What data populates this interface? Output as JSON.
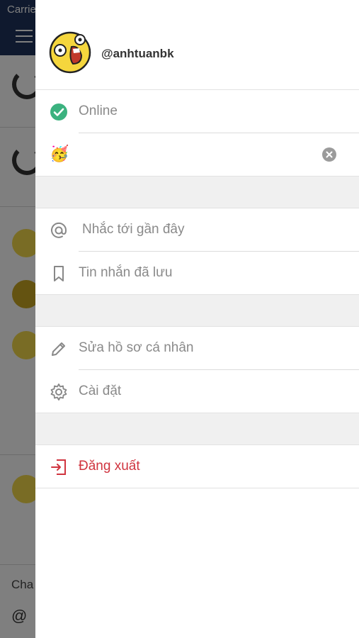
{
  "status_bar": {
    "carrier": "Carrie"
  },
  "background": {
    "footer_text": "Cha",
    "footer_at": "@"
  },
  "drawer": {
    "username": "@anhtuanbk",
    "status": {
      "label": "Online",
      "color": "#3bb27f"
    },
    "custom_status": {
      "emoji": "🥳"
    },
    "items": [
      {
        "label": "Nhắc tới gần đây",
        "icon": "at-icon"
      },
      {
        "label": "Tin nhắn đã lưu",
        "icon": "bookmark-icon"
      },
      {
        "label": "Sửa hồ sơ cá nhân",
        "icon": "pencil-icon"
      },
      {
        "label": "Cài đặt",
        "icon": "gear-icon"
      }
    ],
    "logout": {
      "label": "Đăng xuất",
      "icon": "logout-icon",
      "color": "#d0343f"
    }
  }
}
